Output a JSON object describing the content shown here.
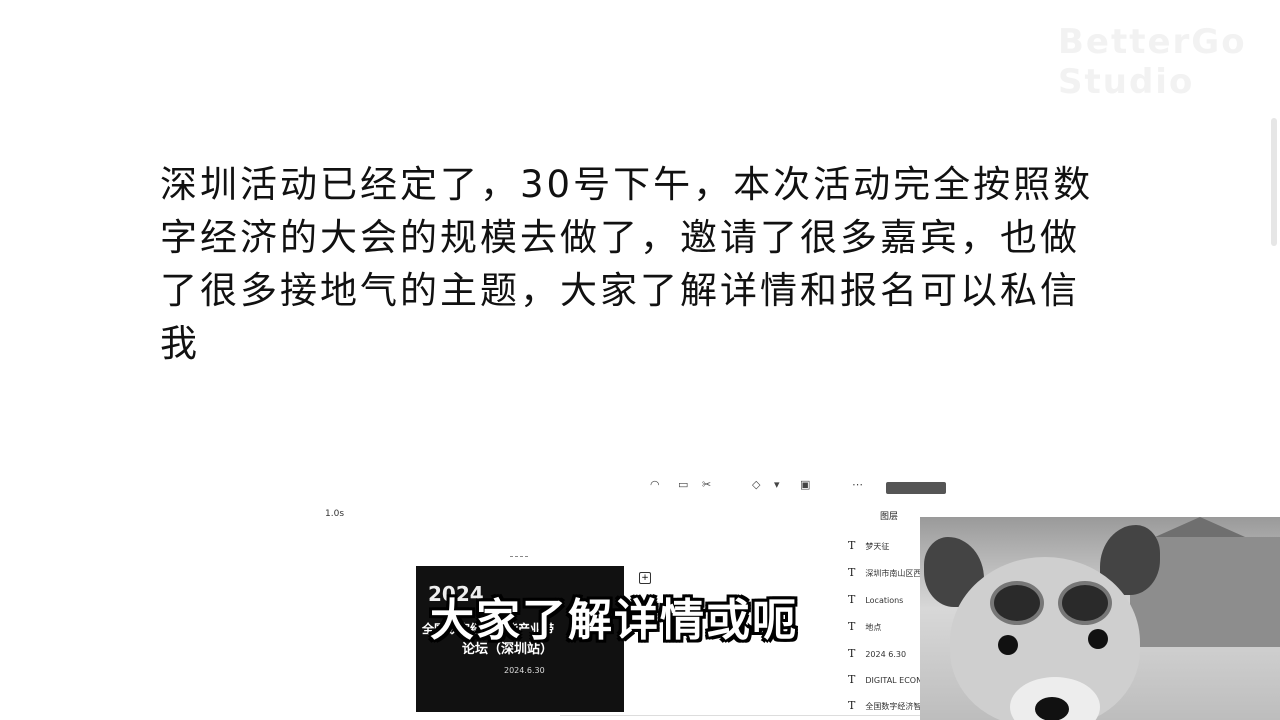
{
  "watermark": "BetterGo Studio",
  "main_text": "深圳活动已经定了，30号下午，本次活动完全按照数字经济的大会的规模去做了，邀请了很多嘉宾，也做了很多接地气的主题，大家了解详情和报名可以私信我",
  "editor": {
    "duration": "1.0s",
    "add_icon": "+"
  },
  "slide": {
    "year": "2024",
    "title_line1": "全国数字经济智能产业带",
    "title_line2": "论坛（深圳站）",
    "date": "2024.6.30"
  },
  "layers": {
    "title": "图层",
    "items": [
      {
        "label": "梦天征"
      },
      {
        "label": "深圳市南山区西"
      },
      {
        "label": "Locations"
      },
      {
        "label": "地点"
      },
      {
        "label": "2024 6.30"
      },
      {
        "label": "DIGITAL ECON"
      },
      {
        "label": "全国数字经济智"
      }
    ]
  },
  "subtitle": "大家了解详情或呃"
}
